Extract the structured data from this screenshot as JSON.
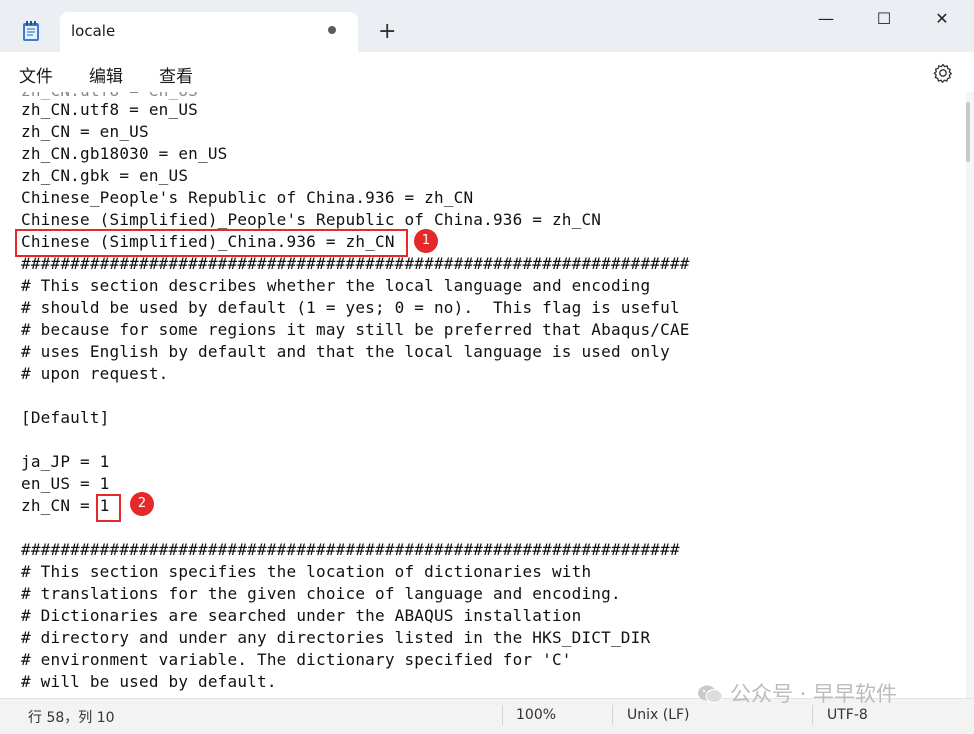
{
  "window": {
    "tab_title": "locale",
    "new_tab_symbol": "+",
    "minimize_symbol": "—",
    "maximize_symbol": "☐",
    "close_symbol": "✕"
  },
  "menu": {
    "file": "文件",
    "edit": "编辑",
    "view": "查看"
  },
  "editor_lines": [
    "zh_CN.utf8 = en_US",
    "zh_CN = en_US",
    "zh_CN.gb18030 = en_US",
    "zh_CN.gbk = en_US",
    "Chinese_People's Republic of China.936 = zh_CN",
    "Chinese (Simplified)_People's Republic of China.936 = zh_CN",
    "Chinese (Simplified)_China.936 = zh_CN",
    "####################################################################",
    "# This section describes whether the local language and encoding",
    "# should be used by default (1 = yes; 0 = no).  This flag is useful",
    "# because for some regions it may still be preferred that Abaqus/CAE",
    "# uses English by default and that the local language is used only",
    "# upon request.",
    "",
    "[Default]",
    "",
    "ja_JP = 1",
    "en_US = 1",
    "zh_CN = 1",
    "",
    "###################################################################",
    "# This section specifies the location of dictionaries with",
    "# translations for the given choice of language and encoding.",
    "# Dictionaries are searched under the ABAQUS installation",
    "# directory and under any directories listed in the HKS_DICT_DIR",
    "# environment variable. The dictionary specified for 'C'",
    "# will be used by default."
  ],
  "annotations": {
    "badge_1": "1",
    "badge_2": "2",
    "color": "#e5292a"
  },
  "status": {
    "position": "行 58，列 10",
    "zoom": "100%",
    "line_ending": "Unix (LF)",
    "encoding": "UTF-8"
  },
  "watermark": {
    "text": "公众号 · 早早软件"
  }
}
